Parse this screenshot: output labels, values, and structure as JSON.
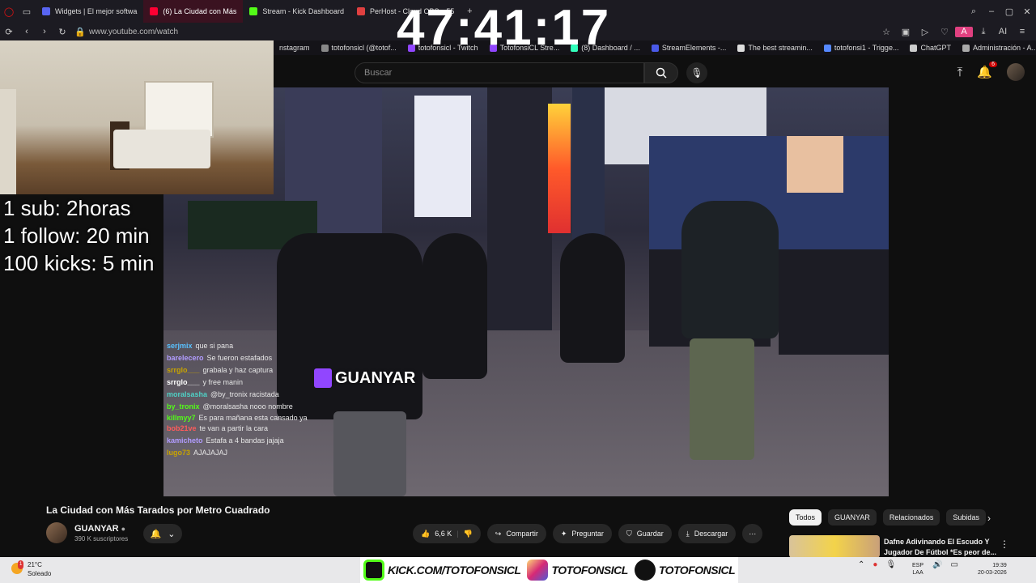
{
  "timer": "47:41:17",
  "browser": {
    "tabs": [
      {
        "label": "Widgets | El mejor softwa",
        "active": false,
        "color": "#5865f2"
      },
      {
        "label": "(6) La Ciudad con Más",
        "active": true,
        "color": "#ff0033"
      },
      {
        "label": "Stream - Kick Dashboard",
        "active": false,
        "color": "#53fc18"
      },
      {
        "label": "PerHost - Cloud OBS v.55",
        "active": false,
        "color": "#e04040"
      }
    ],
    "url": "www.youtube.com/watch",
    "bookmarks": [
      {
        "label": "nstagram"
      },
      {
        "label": "totofonsicl (@totof..."
      },
      {
        "label": "totofonsicl - Twitch"
      },
      {
        "label": "TotofonsiCL Stre..."
      },
      {
        "label": "(8) Dashboard / ..."
      },
      {
        "label": "StreamElements -..."
      },
      {
        "label": "The best streamin..."
      },
      {
        "label": "totofonsi1 - Trigge..."
      },
      {
        "label": "ChatGPT"
      },
      {
        "label": "Administración - A..."
      }
    ]
  },
  "youtube": {
    "search_placeholder": "Buscar",
    "notif_count": "6"
  },
  "goals": {
    "line1": "1 sub: 2horas",
    "line2": "1 follow: 20 min",
    "line3": "100 kicks: 5 min"
  },
  "video": {
    "overlay_name": "GUANYAR"
  },
  "chat": [
    {
      "user": "serjmix",
      "msg": "que si pana",
      "color": "#59c2ff"
    },
    {
      "user": "barelecero",
      "msg": "Se fueron estafados",
      "color": "#b19cff"
    },
    {
      "user": "srrglo___",
      "msg": "grabala y haz captura",
      "color": "#c8a400"
    },
    {
      "user": "srrglo___",
      "msg": "y free manin",
      "color": "#ffffff"
    },
    {
      "user": "moralsasha",
      "msg": "@by_tronix racistada",
      "color": "#4fd1c5"
    },
    {
      "user": "by_tronix",
      "msg": "@moralsasha nooo nombre",
      "color": "#53fc18"
    },
    {
      "user": "killmyy7",
      "msg": "Es para mañana esta cansado ya",
      "color": "#53fc18"
    },
    {
      "user": "bob21ve",
      "msg": "te van a partir la cara",
      "color": "#ff5b5b"
    },
    {
      "user": "kamicheto",
      "msg": "Estafa a 4 bandas jajaja",
      "color": "#b19cff"
    },
    {
      "user": "lugo73",
      "msg": "AJAJAJAJ",
      "color": "#c8a400"
    }
  ],
  "video_info": {
    "title": "La Ciudad con Más Tarados por Metro Cuadrado",
    "channel": "GUANYAR",
    "subscribers": "390 K suscriptores",
    "likes": "6,6 K",
    "share": "Compartir",
    "ask": "Preguntar",
    "save": "Guardar",
    "download": "Descargar"
  },
  "chips": [
    "Todos",
    "GUANYAR",
    "Relacionados",
    "Subidas"
  ],
  "recommendation": {
    "title": "Dafne Adivinando El Escudo Y Jugador De Fútbol *Es peor de..."
  },
  "sidebar_label": "GX",
  "taskbar": {
    "temp": "21°C",
    "condition": "Soleado",
    "weather_badge": "1",
    "kick": "KICK.COM/TOTOFONSICL",
    "instagram": "TOTOFONSICL",
    "tiktok": "TOTOFONSICL",
    "lang1": "ESP",
    "lang2": "LAA",
    "time": "19:39",
    "date": "20-03-2026"
  }
}
